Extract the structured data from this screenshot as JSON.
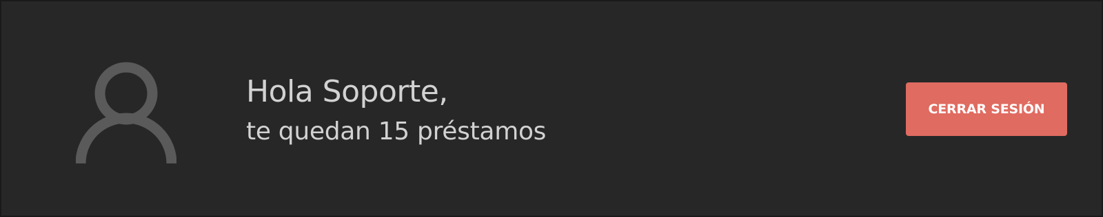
{
  "user": {
    "avatar_icon": "user-icon",
    "greeting": "Hola Soporte,",
    "loans_message": "te quedan 15 préstamos"
  },
  "actions": {
    "logout_label": "CERRAR SESIÓN"
  },
  "colors": {
    "background": "#272727",
    "text": "#d2d2d2",
    "avatar": "#5a5a5a",
    "logout_button": "#e06b61",
    "logout_text": "#ffffff"
  }
}
